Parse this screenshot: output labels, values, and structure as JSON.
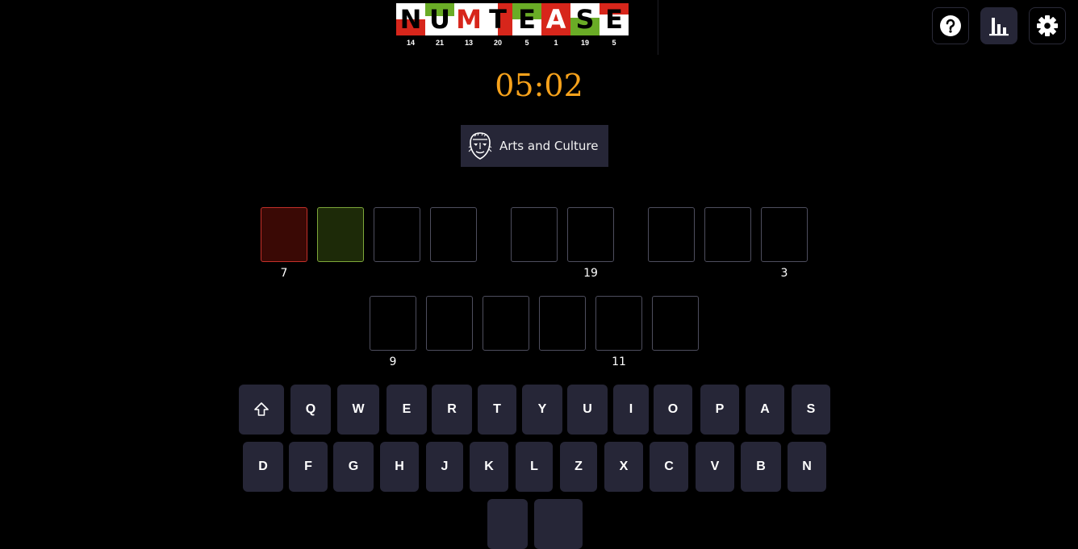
{
  "logo": {
    "letters": [
      {
        "char": "N",
        "num": "14",
        "band": "#d7261b",
        "band_pos": "bottom",
        "band_h": 20
      },
      {
        "char": "U",
        "num": "21",
        "band": "#6aac26",
        "band_pos": "top",
        "band_h": 16
      },
      {
        "char": "M",
        "num": "13",
        "band": "#ffffff",
        "band_pos": "none",
        "band_h": 0
      },
      {
        "char": "T",
        "num": "20",
        "band": "#d7261b",
        "band_pos": "right",
        "band_h": 0
      },
      {
        "char": "E",
        "num": "5",
        "band": "#6aac26",
        "band_pos": "top",
        "band_h": 20
      },
      {
        "char": "A",
        "num": "1",
        "band": "#d7261b",
        "band_pos": "full",
        "band_h": 40
      },
      {
        "char": "S",
        "num": "19",
        "band": "#6aac26",
        "band_pos": "bottom",
        "band_h": 22
      },
      {
        "char": "E",
        "num": "5",
        "band": "#d7261b",
        "band_pos": "top",
        "band_h": 14
      }
    ]
  },
  "header": {
    "help_icon": "question-circle-icon",
    "stats_icon": "bar-chart-icon",
    "settings_icon": "gear-icon"
  },
  "timer": "05:02",
  "category": {
    "icon": "mask-icon",
    "label": "Arts and Culture"
  },
  "puzzle": {
    "rows": [
      {
        "boxes": [
          {
            "state": "red",
            "letter": ""
          },
          {
            "state": "green",
            "letter": ""
          },
          {
            "state": "empty",
            "letter": ""
          },
          {
            "state": "empty",
            "letter": ""
          },
          {
            "state": "empty",
            "letter": ""
          },
          {
            "state": "empty",
            "letter": ""
          },
          {
            "state": "empty",
            "letter": ""
          },
          {
            "state": "empty",
            "letter": ""
          },
          {
            "state": "empty",
            "letter": ""
          }
        ],
        "hints": [
          "7",
          "19",
          "3"
        ]
      },
      {
        "boxes": [
          {
            "state": "empty",
            "letter": ""
          },
          {
            "state": "empty",
            "letter": ""
          },
          {
            "state": "empty",
            "letter": ""
          },
          {
            "state": "empty",
            "letter": ""
          },
          {
            "state": "empty",
            "letter": ""
          },
          {
            "state": "empty",
            "letter": ""
          }
        ],
        "hints": [
          "9",
          "11"
        ]
      }
    ]
  },
  "keyboard": {
    "shift_icon": "shift-arrow-icon",
    "row1": [
      "Q",
      "W",
      "E",
      "R",
      "T",
      "Y",
      "U",
      "I",
      "O",
      "P",
      "A",
      "S"
    ],
    "row2": [
      "D",
      "F",
      "G",
      "H",
      "J",
      "K",
      "L",
      "Z",
      "X",
      "C",
      "V",
      "B",
      "N"
    ]
  }
}
